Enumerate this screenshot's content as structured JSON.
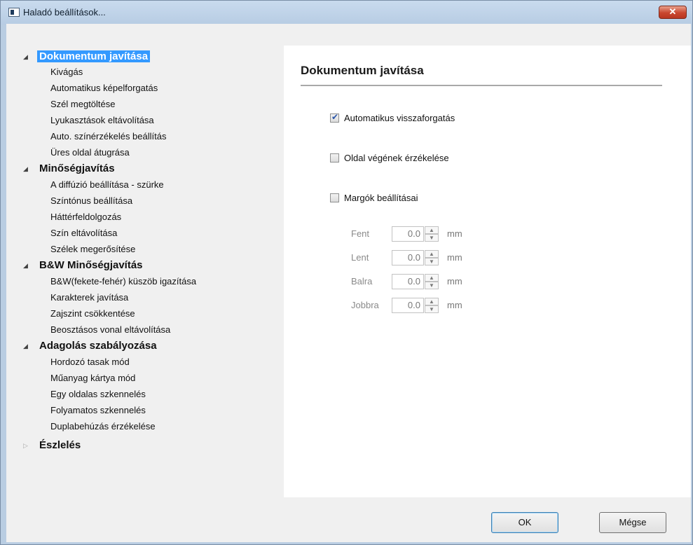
{
  "window": {
    "title": "Haladó beállítások...",
    "close_glyph": "✕"
  },
  "tree": {
    "categories": [
      {
        "label": "Dokumentum javítása",
        "items": [
          "Kivágás",
          "Automatikus képelforgatás",
          "Szél megtöltése",
          "Lyukasztások eltávolítása",
          "Auto. színérzékelés beállítás",
          "Üres oldal átugrása"
        ]
      },
      {
        "label": "Minőségjavítás",
        "items": [
          "A diffúzió beállítása - szürke",
          "Színtónus beállítása",
          "Háttérfeldolgozás",
          "Szín eltávolítása",
          "Szélek megerősítése"
        ]
      },
      {
        "label": "B&W Minőségjavítás",
        "items": [
          "B&W(fekete-fehér) küszöb igazítása",
          "Karakterek javítása",
          "Zajszint csökkentése",
          "Beosztásos vonal eltávolítása"
        ]
      },
      {
        "label": "Adagolás szabályozása",
        "items": [
          "Hordozó tasak mód",
          "Műanyag kártya mód",
          "Egy oldalas szkennelés",
          "Folyamatos szkennelés",
          "Duplabehúzás érzékelése"
        ]
      },
      {
        "label": "Észlelés",
        "items": []
      }
    ],
    "expanded_glyph": "◢",
    "collapsed_glyph": "▷"
  },
  "panel": {
    "title": "Dokumentum javítása",
    "checkboxes": [
      {
        "label": "Automatikus visszaforgatás",
        "checked": true
      },
      {
        "label": "Oldal végének érzékelése",
        "checked": false
      },
      {
        "label": "Margók beállításai",
        "checked": false
      }
    ],
    "margins": [
      {
        "label": "Fent",
        "value": "0.0",
        "unit": "mm"
      },
      {
        "label": "Lent",
        "value": "0.0",
        "unit": "mm"
      },
      {
        "label": "Balra",
        "value": "0.0",
        "unit": "mm"
      },
      {
        "label": "Jobbra",
        "value": "0.0",
        "unit": "mm"
      }
    ]
  },
  "buttons": {
    "ok": "OK",
    "cancel": "Mégse"
  }
}
